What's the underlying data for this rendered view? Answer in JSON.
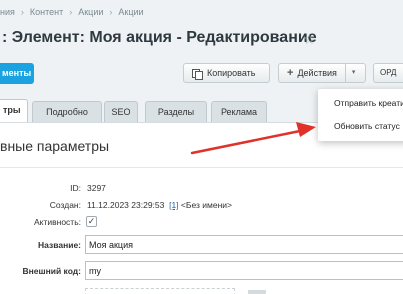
{
  "breadcrumb": {
    "items": [
      "ния",
      "Контент",
      "Акции",
      "Акции"
    ],
    "separator": "›"
  },
  "header": {
    "title": ": Элемент: Моя акция - Редактирование",
    "star_icon": "☆"
  },
  "toolbar": {
    "primary_label": "менты",
    "copy_label": "Копировать",
    "actions_label": "Действия",
    "actions_plus": "+",
    "actions_chevron": "▾",
    "extra_label": "ОРД"
  },
  "tabs": [
    {
      "label": "тры",
      "active": true
    },
    {
      "label": "Подробно",
      "active": false
    },
    {
      "label": "SEO",
      "active": false
    },
    {
      "label": "Разделы",
      "active": false
    },
    {
      "label": "Реклама",
      "active": false
    }
  ],
  "section": {
    "title": "вные параметры"
  },
  "fields": {
    "id_label": "ID:",
    "id_value": "3297",
    "created_label": "Создан:",
    "created_value": "11.12.2023 23:29:53",
    "created_user_link": "[1]",
    "created_user_name": "<Без имени>",
    "active_label": "Активность:",
    "active_check": "✓",
    "name_label": "Название:",
    "name_value": "Моя акция",
    "external_code_label": "Внешний код:",
    "external_code_value": "my"
  },
  "dropdown_menu": {
    "items": [
      "Отправить креатив",
      "Обновить статус"
    ]
  },
  "colors": {
    "accent_blue": "#1aa3e0",
    "annotation_arrow": "#e0312a",
    "link": "#2067b0"
  }
}
